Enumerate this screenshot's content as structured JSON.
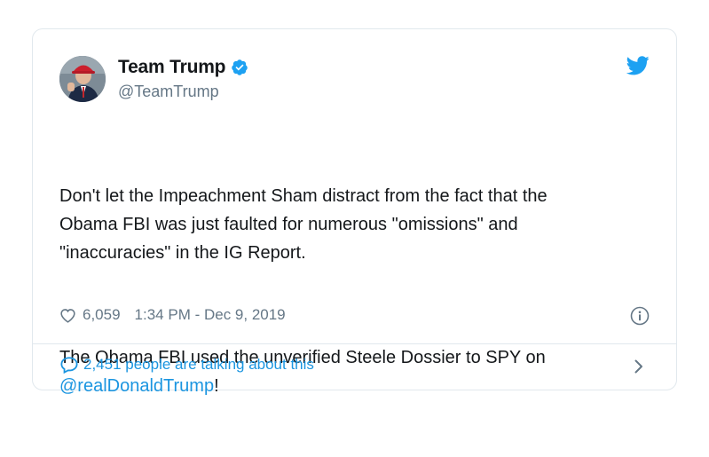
{
  "tweet": {
    "display_name": "Team Trump",
    "handle": "@TeamTrump",
    "paragraph_1": "Don't let the Impeachment Sham distract from the fact that the\nObama FBI was just faulted for numerous \"omissions\" and\n\"inaccuracies\" in the IG Report.",
    "paragraph_2_text": "The Obama FBI used the unverified Steele Dossier to SPY on\n",
    "mention": "@realDonaldTrump",
    "paragraph_2_end": "!",
    "likes": "6,059",
    "timestamp": "1:34 PM - Dec 9, 2019",
    "talking": "2,451 people are talking about this"
  },
  "icons": {
    "verified": "verified-badge-icon",
    "bird": "twitter-bird-icon",
    "heart": "heart-icon",
    "info": "info-icon",
    "bubble": "speech-bubble-icon",
    "chevron": "chevron-right-icon"
  },
  "colors": {
    "brand_blue": "#1da1f2",
    "link_blue": "#1b95e0",
    "text": "#14171a",
    "muted": "#657786",
    "border": "#e1e8ed"
  }
}
